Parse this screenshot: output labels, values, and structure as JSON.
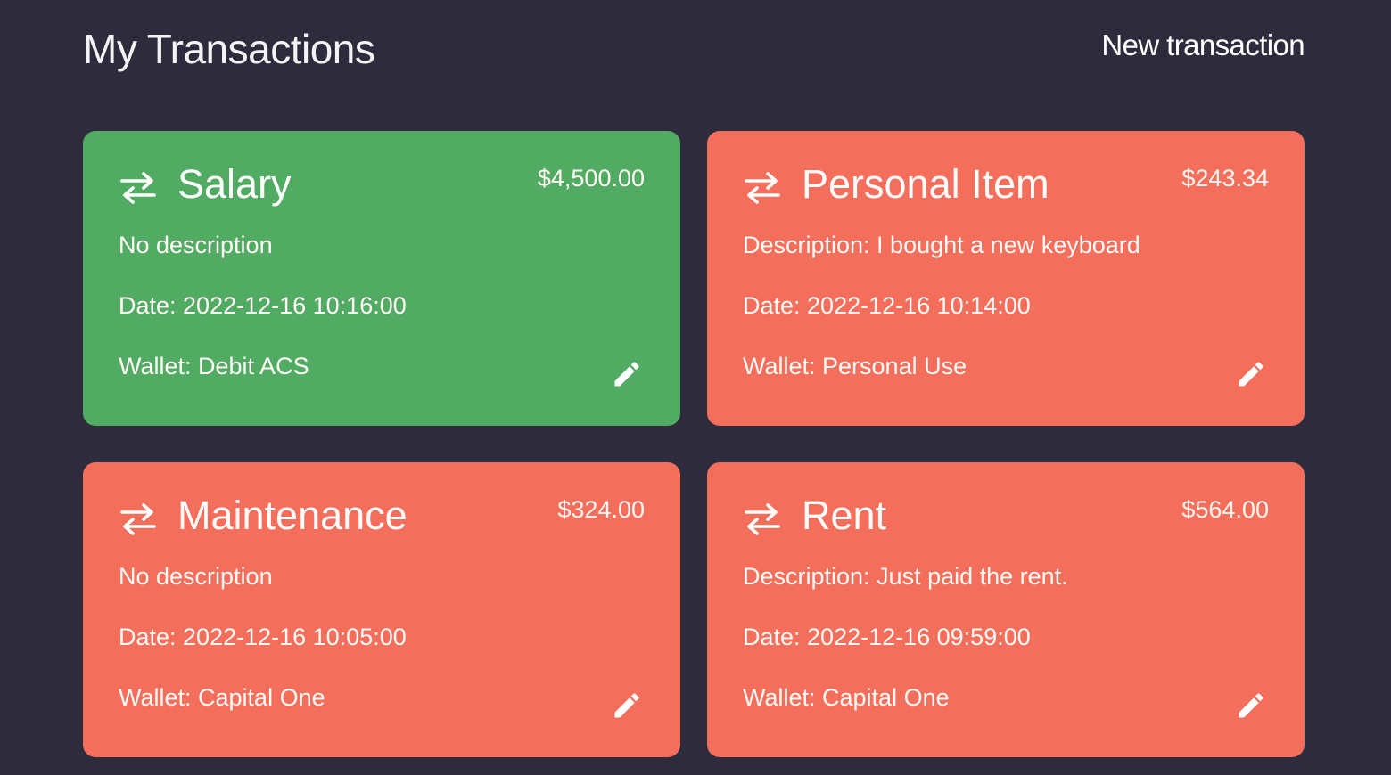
{
  "header": {
    "title": "My Transactions",
    "new_transaction_label": "New transaction"
  },
  "colors": {
    "background": "#2e2b3c",
    "income": "#52ab63",
    "expense": "#f36e5b"
  },
  "icons": {
    "transaction": "swap-arrows-icon",
    "edit": "pencil-icon"
  },
  "transactions": [
    {
      "type": "income",
      "title": "Salary",
      "amount": "$4,500.00",
      "description": "No description",
      "date": "Date: 2022-12-16 10:16:00",
      "wallet": "Wallet: Debit ACS"
    },
    {
      "type": "expense",
      "title": "Personal Item",
      "amount": "$243.34",
      "description": "Description: I bought a new keyboard",
      "date": "Date: 2022-12-16 10:14:00",
      "wallet": "Wallet: Personal Use"
    },
    {
      "type": "expense",
      "title": "Maintenance",
      "amount": "$324.00",
      "description": "No description",
      "date": "Date: 2022-12-16 10:05:00",
      "wallet": "Wallet: Capital One"
    },
    {
      "type": "expense",
      "title": "Rent",
      "amount": "$564.00",
      "description": "Description: Just paid the rent.",
      "date": "Date: 2022-12-16 09:59:00",
      "wallet": "Wallet: Capital One"
    }
  ]
}
